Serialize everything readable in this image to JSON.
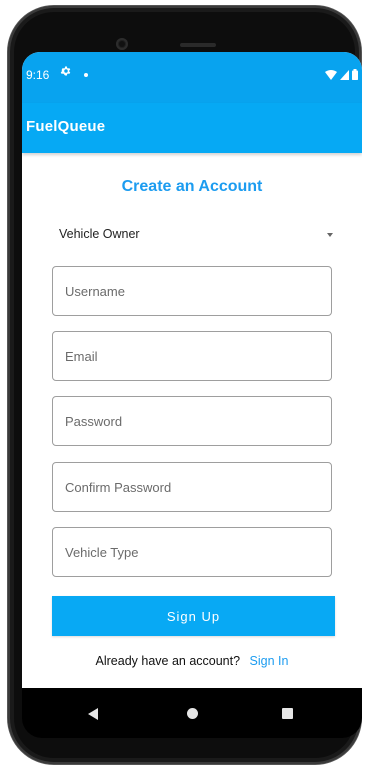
{
  "status_bar": {
    "time": "9:16",
    "background": "#08a3ef"
  },
  "app_bar": {
    "title": "FuelQueue",
    "background": "#06a9f4"
  },
  "form": {
    "title": "Create an Account",
    "role_select": {
      "value": "Vehicle Owner"
    },
    "fields": {
      "username": {
        "placeholder": "Username"
      },
      "email": {
        "placeholder": "Email"
      },
      "password": {
        "placeholder": "Password"
      },
      "confirm_password": {
        "placeholder": "Confirm Password"
      },
      "vehicle_type": {
        "placeholder": "Vehicle Type"
      }
    },
    "submit_label": "Sign Up",
    "signin_prompt": "Already have an account?",
    "signin_link": "Sign In"
  },
  "colors": {
    "accent": "#1c9cf0",
    "button": "#08a9f4"
  },
  "icons": {
    "status_left": [
      "settings-gear-icon",
      "notification-dot-icon"
    ],
    "status_right": [
      "wifi-icon",
      "signal-icon",
      "battery-icon"
    ],
    "nav": [
      "nav-back-icon",
      "nav-home-icon",
      "nav-recents-icon"
    ]
  }
}
